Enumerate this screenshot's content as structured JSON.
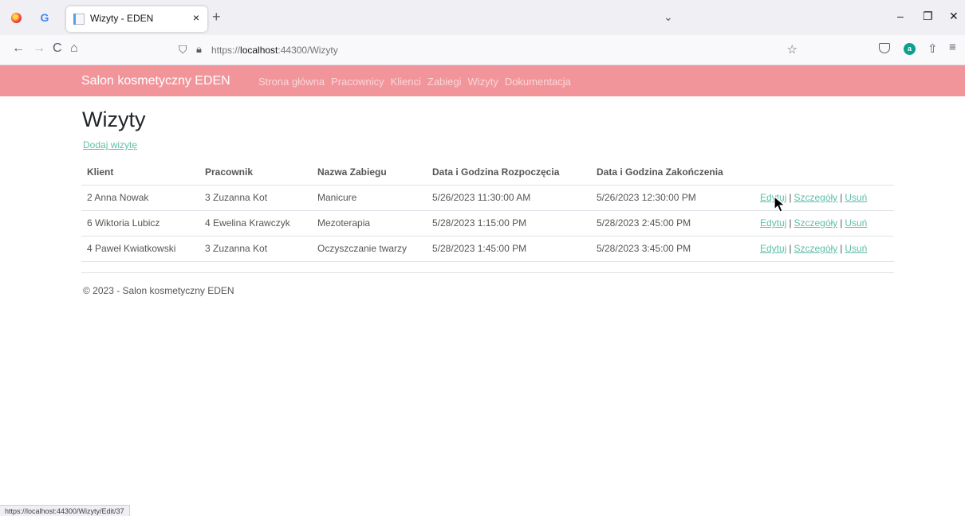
{
  "browser": {
    "tab_title": "Wizyty - EDEN",
    "tab_close": "×",
    "new_tab": "+",
    "tabs_list": "⌄",
    "win_minimize": "–",
    "win_restore": "❐",
    "win_close": "✕",
    "g_icon": "G",
    "back": "←",
    "forward": "→",
    "reload": "C",
    "home": "⌂",
    "url_shield": "⛉",
    "url_lock": "🔒︎",
    "url_prefix": "https://",
    "url_host": "localhost",
    "url_rest": ":44300/Wizyty",
    "bookmark_star": "☆",
    "ext_letter": "a",
    "share": "⇧",
    "menu": "≡",
    "status_url": "https://localhost:44300/Wizyty/Edit/37"
  },
  "site": {
    "brand": "Salon kosmetyczny EDEN",
    "nav_links": [
      "Strona główna",
      "Pracownicy",
      "Klienci",
      "Zabiegi",
      "Wizyty",
      "Dokumentacja"
    ]
  },
  "page": {
    "title": "Wizyty",
    "add_link": "Dodaj wizytę"
  },
  "table": {
    "headers": [
      "Klient",
      "Pracownik",
      "Nazwa Zabiegu",
      "Data i Godzina Rozpoczęcia",
      "Data i Godzina Zakończenia"
    ],
    "rows": [
      [
        "2 Anna Nowak",
        "3 Zuzanna Kot",
        "Manicure",
        "5/26/2023 11:30:00 AM",
        "5/26/2023 12:30:00 PM"
      ],
      [
        "6 Wiktoria Lubicz",
        "4 Ewelina Krawczyk",
        "Mezoterapia",
        "5/28/2023 1:15:00 PM",
        "5/28/2023 2:45:00 PM"
      ],
      [
        "4 Paweł Kwiatkowski",
        "3 Zuzanna Kot",
        "Oczyszczanie twarzy",
        "5/28/2023 1:45:00 PM",
        "5/28/2023 3:45:00 PM"
      ]
    ],
    "actions": {
      "edit": "Edytuj",
      "details": "Szczegóły",
      "delete": "Usuń",
      "separator": "|"
    }
  },
  "footer": {
    "text": "© 2023 - Salon kosmetyczny EDEN"
  },
  "colors": {
    "navbar": "#f2959a",
    "link": "#5fbfa8"
  }
}
